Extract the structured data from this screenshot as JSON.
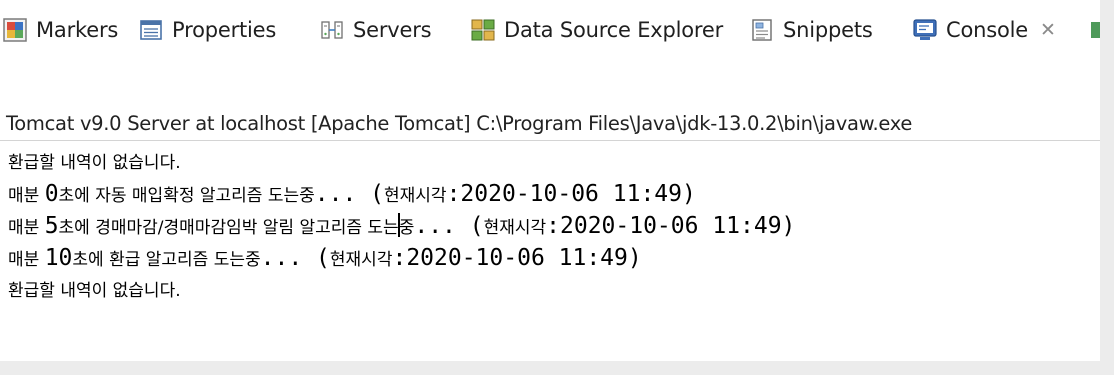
{
  "tabs": [
    {
      "label": "Markers",
      "icon": "markers-icon"
    },
    {
      "label": "Properties",
      "icon": "properties-icon"
    },
    {
      "label": "Servers",
      "icon": "servers-icon"
    },
    {
      "label": "Data Source Explorer",
      "icon": "data-source-explorer-icon"
    },
    {
      "label": "Snippets",
      "icon": "snippets-icon"
    },
    {
      "label": "Console",
      "icon": "console-icon",
      "active": true,
      "close": "✕"
    }
  ],
  "console": {
    "title": "Tomcat v9.0 Server at localhost [Apache Tomcat] C:\\Program Files\\Java\\jdk-13.0.2\\bin\\javaw.exe",
    "lines": [
      {
        "parts": [
          "환급할 내역이 없습니다."
        ]
      },
      {
        "parts": [
          "매분 ",
          "0",
          "초에 자동 매입확정 알고리즘 도는중",
          "... (",
          "현재시각",
          ":2020-10-06 11:49)"
        ]
      },
      {
        "parts": [
          "매분 ",
          "5",
          "초에 경매마감/경매마감임박 알림 알고리즘 도는",
          "중",
          "... (",
          "현재시각",
          ":2020-10-06 11:49)"
        ]
      },
      {
        "parts": [
          "매분 ",
          "10",
          "초에 환급 알고리즘 도는중",
          "... (",
          "현재시각",
          ":2020-10-06 11:49)"
        ]
      },
      {
        "parts": [
          "환급할 내역이 없습니다."
        ]
      }
    ]
  },
  "colors": {
    "active_tab_bg": "#ffffff",
    "text": "#1f1f1f",
    "console_text": "#000000"
  }
}
